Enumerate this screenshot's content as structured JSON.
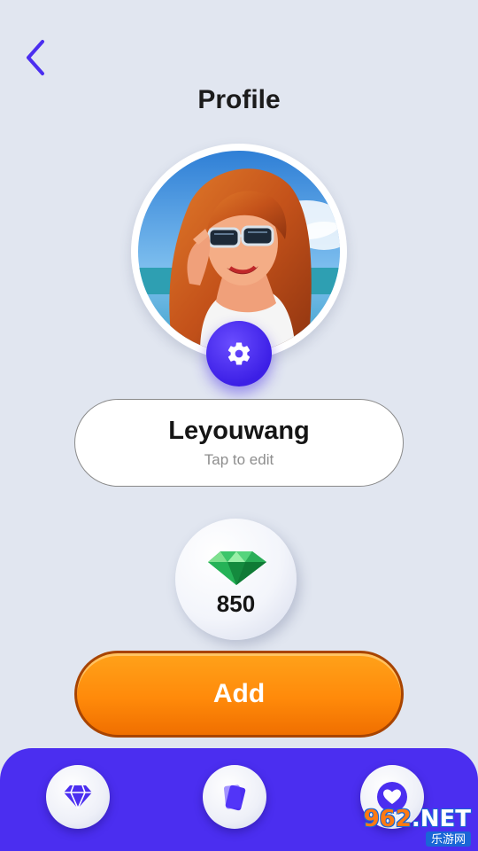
{
  "header": {
    "back_icon": "chevron-left-icon",
    "title": "Profile"
  },
  "profile": {
    "avatar": "avatar-illustration",
    "settings_icon": "gear-icon",
    "name": "Leyouwang",
    "edit_hint": "Tap to edit"
  },
  "wallet": {
    "icon": "emerald-gem-icon",
    "count": "850"
  },
  "add_button": {
    "label": "Add"
  },
  "bottom_nav": [
    {
      "icon": "diamond-icon"
    },
    {
      "icon": "cards-icon"
    },
    {
      "icon": "heart-icon"
    }
  ],
  "watermark": {
    "main_prefix": "962",
    "main_suffix": ".NET",
    "sub": "乐游网"
  },
  "colors": {
    "background": "#e1e6f0",
    "accent": "#4b2ef0",
    "add_button": "#ff8a0a",
    "gem": "#22b85a"
  }
}
